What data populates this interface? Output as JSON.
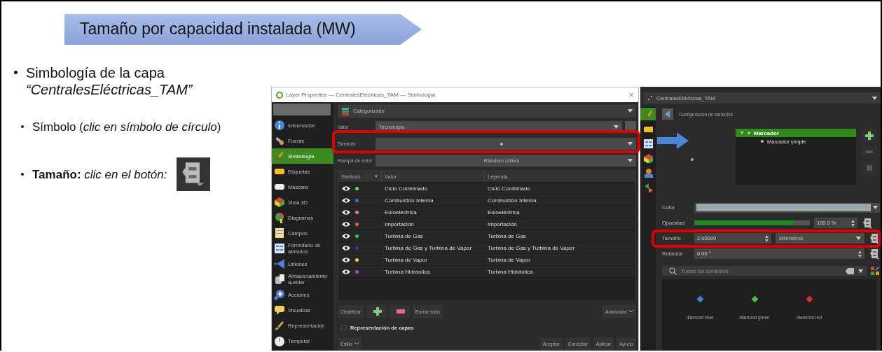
{
  "slide": {
    "title": "Tamaño por capacidad instalada (MW)",
    "bullets": [
      {
        "text": "Simbología de la capa *“CentralesEléctricas_TAM”*",
        "children": [
          {
            "text": "Símbolo (*clic en símbolo de círculo*)",
            "button_icon": false
          },
          {
            "text": "**Tamaño:** *clic en el botón:*",
            "button_icon": true
          }
        ]
      }
    ]
  },
  "layer_properties": {
    "title": "Layer Properties — CentralesEléctricas_TAM — Simbología",
    "close": "×",
    "sidebar": [
      {
        "label": "Información",
        "selected": false
      },
      {
        "label": "Fuente",
        "selected": false
      },
      {
        "label": "Simbología",
        "selected": true
      },
      {
        "label": "Etiquetas",
        "selected": false
      },
      {
        "label": "Máscara",
        "selected": false
      },
      {
        "label": "Vista 3D",
        "selected": false
      },
      {
        "label": "Diagramas",
        "selected": false
      },
      {
        "label": "Campos",
        "selected": false
      },
      {
        "label": "Formulario de atributos",
        "selected": false
      },
      {
        "label": "Uniones",
        "selected": false
      },
      {
        "label": "Almacenamiento auxiliar",
        "selected": false
      },
      {
        "label": "Acciones",
        "selected": false
      },
      {
        "label": "Visualizar",
        "selected": false
      },
      {
        "label": "Representación",
        "selected": false
      },
      {
        "label": "Temporal",
        "selected": false
      }
    ],
    "renderer": "Categorizado",
    "value_label": "Valor",
    "value": "Tecnología",
    "symbol_label": "Símbolo",
    "color_ramp_label": "Rampa de color",
    "color_ramp": "Random colors",
    "table": {
      "columns": [
        "Símbolo",
        "Valor",
        "Leyenda"
      ],
      "sort_indicator": "▼",
      "rows": [
        {
          "visible": true,
          "color": "#8fd14f",
          "value": "Ciclo Combinado",
          "legend": "Ciclo Combinado"
        },
        {
          "visible": true,
          "color": "#3a78d8",
          "value": "Combustión Interna",
          "legend": "Combustión Interna"
        },
        {
          "visible": true,
          "color": "#e57aa0",
          "value": "Eoloeléctrica",
          "legend": "Eoloeléctrica"
        },
        {
          "visible": true,
          "color": "#e0603a",
          "value": "Importación",
          "legend": "Importación"
        },
        {
          "visible": true,
          "color": "#2ecc40",
          "value": "Turbina de Gas",
          "legend": "Turbina de Gas"
        },
        {
          "visible": true,
          "color": "#3a2fbf",
          "value": "Turbina de Gas y Turbina de Vapor",
          "legend": "Turbina de Gas y Turbina de Vapor"
        },
        {
          "visible": true,
          "color": "#f0d040",
          "value": "Turbina de Vapor",
          "legend": "Turbina de Vapor"
        },
        {
          "visible": true,
          "color": "#c040d0",
          "value": "Turbina Hidráulica",
          "legend": "Turbina Hidráulica"
        }
      ]
    },
    "classify": "Clasificar",
    "delete_all": "Borrar todo",
    "advanced": "Avanzado",
    "layer_rendering": {
      "label": "Representación de capas",
      "checked": false
    },
    "style": "Estilo",
    "dialog_buttons": [
      "Aceptar",
      "Cancelar",
      "Aplicar",
      "Ayuda"
    ]
  },
  "symbol_panel": {
    "layer": "CentralesEléctricas_TAM",
    "side_tabs": [
      {
        "selected": true
      },
      {
        "selected": false
      },
      {
        "selected": false
      },
      {
        "selected": false
      },
      {
        "selected": false
      },
      {
        "selected": false
      }
    ],
    "title": "Configuración de símbolos",
    "tree": [
      {
        "label": "Marcador",
        "selected": true,
        "expanded": true,
        "children": [
          {
            "label": "Marcador simple",
            "selected": false
          }
        ]
      }
    ],
    "color_label": "Color",
    "opacity": {
      "label": "Opacidad",
      "level": 0.86,
      "reading": "100.0 %"
    },
    "size": {
      "label": "Tamaño",
      "value": "2.00000",
      "unit": "Milímetros"
    },
    "rotation": {
      "label": "Rotación",
      "value": "0.00 °"
    },
    "library_search": {
      "placeholder": "Todos los símbolos"
    },
    "symbols": [
      {
        "name": "diamond blue",
        "color": "#3f7fd6"
      },
      {
        "name": "diamond green",
        "color": "#4cbb4c"
      },
      {
        "name": "diamond red",
        "color": "#e02a2a"
      }
    ]
  }
}
